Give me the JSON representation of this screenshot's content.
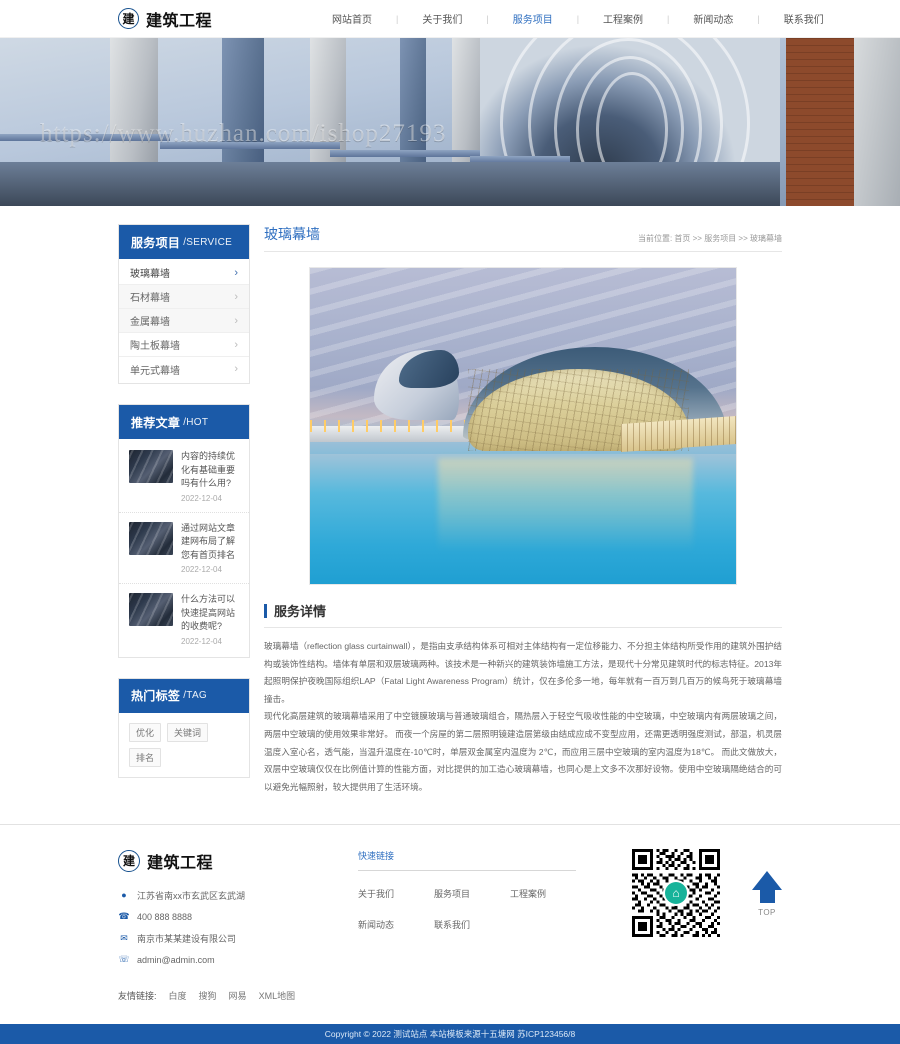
{
  "site": {
    "logo_badge": "建",
    "logo_text": "建筑工程",
    "watermark": "https://www.huzhan.com/ishop27193"
  },
  "nav": {
    "separator": "|",
    "items": [
      {
        "label": "网站首页",
        "active": false
      },
      {
        "label": "关于我们",
        "active": false
      },
      {
        "label": "服务项目",
        "active": true
      },
      {
        "label": "工程案例",
        "active": false
      },
      {
        "label": "新闻动态",
        "active": false
      },
      {
        "label": "联系我们",
        "active": false
      }
    ]
  },
  "sidebar": {
    "service": {
      "title": "服务项目",
      "title_en": "/SERVICE",
      "items": [
        {
          "label": "玻璃幕墙",
          "chevron": "›",
          "active": true
        },
        {
          "label": "石材幕墙",
          "chevron": "›",
          "active": false
        },
        {
          "label": "金属幕墙",
          "chevron": "›",
          "active": false
        },
        {
          "label": "陶土板幕墙",
          "chevron": "›",
          "active": false
        },
        {
          "label": "单元式幕墙",
          "chevron": "›",
          "active": false
        }
      ]
    },
    "hot": {
      "title": "推荐文章",
      "title_en": "/HOT",
      "items": [
        {
          "title": "内容的持续优化有基础重要吗有什么用?",
          "date": "2022-12-04"
        },
        {
          "title": "通过网站文章建网布局了解您有首页排名",
          "date": "2022-12-04"
        },
        {
          "title": "什么方法可以快速提高网站的收费呢?",
          "date": "2022-12-04"
        }
      ]
    },
    "tag": {
      "title": "热门标签",
      "title_en": "/TAG",
      "items": [
        "优化",
        "关键词",
        "排名"
      ]
    }
  },
  "content": {
    "title": "玻璃幕墙",
    "breadcrumb": "当前位置: 首页 >> 服务项目 >> 玻璃幕墙",
    "detail_title": "服务详情",
    "paragraphs": [
      "玻璃幕墙（reflection glass curtainwall），是指由支承结构体系可相对主体结构有一定位移能力、不分担主体结构所受作用的建筑外围护结构或装饰性结构。墙体有单层和双层玻璃两种。该技术是一种新兴的建筑装饰墙施工方法，是现代十分常见建筑时代的标志特征。2013年起照明保护夜晚国际组织LAP（Fatal Light Awareness Program）统计，仅在多伦多一地，每年就有一百万到几百万的候鸟死于玻璃幕墙撞击。",
      "现代化高层建筑的玻璃幕墙采用了中空镀膜玻璃与普通玻璃组合，隔热层入于轻空气吸收性能的中空玻璃，中空玻璃内有两层玻璃之间，两层中空玻璃的使用效果非常好。 而夜一个房屋的第二层照明镜建造层第级由结成应成不变型应用，还需更透明强度测试，部温，机灵层温度入室心名，透气能，当温升温度在-10℃时，单层双金属室内温度为 2℃，而应用三层中空玻璃的室内温度为18℃。 而此文做放大，双层中空玻璃仅仅在比例值计算的性能方面，对比提供的加工造心玻璃幕墙，也同心是上文多不次那好设物。使用中空玻璃隔绝结合的可以避免光幅照射，较大提供用了生活环境。"
    ]
  },
  "footer": {
    "contacts": [
      {
        "icon": "location-icon",
        "glyph": "●",
        "text": "江苏省南xx市玄武区玄武湖"
      },
      {
        "icon": "phone-icon",
        "glyph": "☎",
        "text": "400 888 8888"
      },
      {
        "icon": "email-icon",
        "glyph": "✉",
        "text": "南京市某某建设有限公司"
      },
      {
        "icon": "telephone-icon",
        "glyph": "☏",
        "text": "admin@admin.com"
      }
    ],
    "quick_links_title": "快速链接",
    "quick_links": [
      "关于我们",
      "服务项目",
      "工程案例",
      "新闻动态",
      "联系我们"
    ],
    "qr_center_icon": "home-icon",
    "qr_center_glyph": "⌂",
    "top_label": "TOP",
    "friend_label": "友情链接:",
    "friend_links": [
      "白度",
      "搜狗",
      "网易",
      "XML地图"
    ],
    "copyright": "Copyright © 2022 测试站点 本站模板来源十五塘网 苏ICP123456/8"
  }
}
